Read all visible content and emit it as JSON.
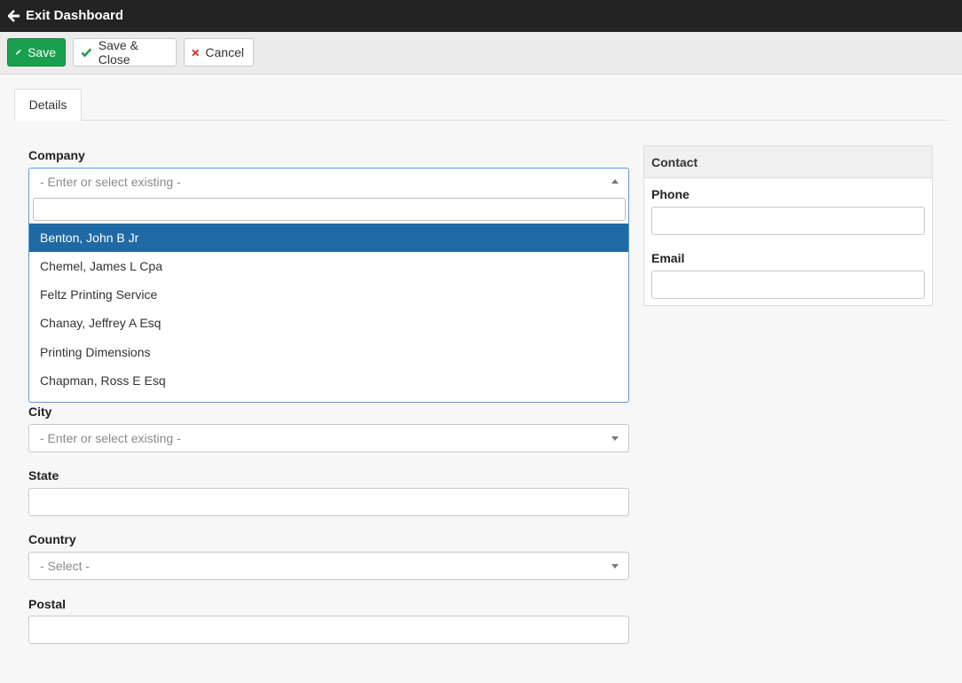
{
  "topbar": {
    "exit_label": "Exit Dashboard"
  },
  "toolbar": {
    "save_label": "Save",
    "save_close_label": "Save & Close",
    "cancel_label": "Cancel"
  },
  "tabs": [
    {
      "label": "Details"
    }
  ],
  "form": {
    "company": {
      "label": "Company",
      "placeholder": "- Enter or select existing -"
    },
    "company_options": [
      "Benton, John B Jr",
      "Chemel, James L Cpa",
      "Feltz Printing Service",
      "Chanay, Jeffrey A Esq",
      "Printing Dimensions",
      "Chapman, Ross E Esq"
    ],
    "city": {
      "label": "City",
      "placeholder": "- Enter or select existing -"
    },
    "state": {
      "label": "State"
    },
    "country": {
      "label": "Country",
      "placeholder": "- Select -"
    },
    "postal": {
      "label": "Postal"
    }
  },
  "contact": {
    "title": "Contact",
    "phone_label": "Phone",
    "email_label": "Email"
  },
  "colors": {
    "save_green": "#1a9f4e",
    "check_green": "#1a9f4e",
    "cancel_red": "#d32f2f",
    "selected_blue": "#1f6aa5",
    "topbar": "#232323"
  },
  "icons": {
    "exit": "arrow-left-icon",
    "save": "pencil-icon",
    "save_close": "check-icon",
    "cancel": "x-icon"
  }
}
